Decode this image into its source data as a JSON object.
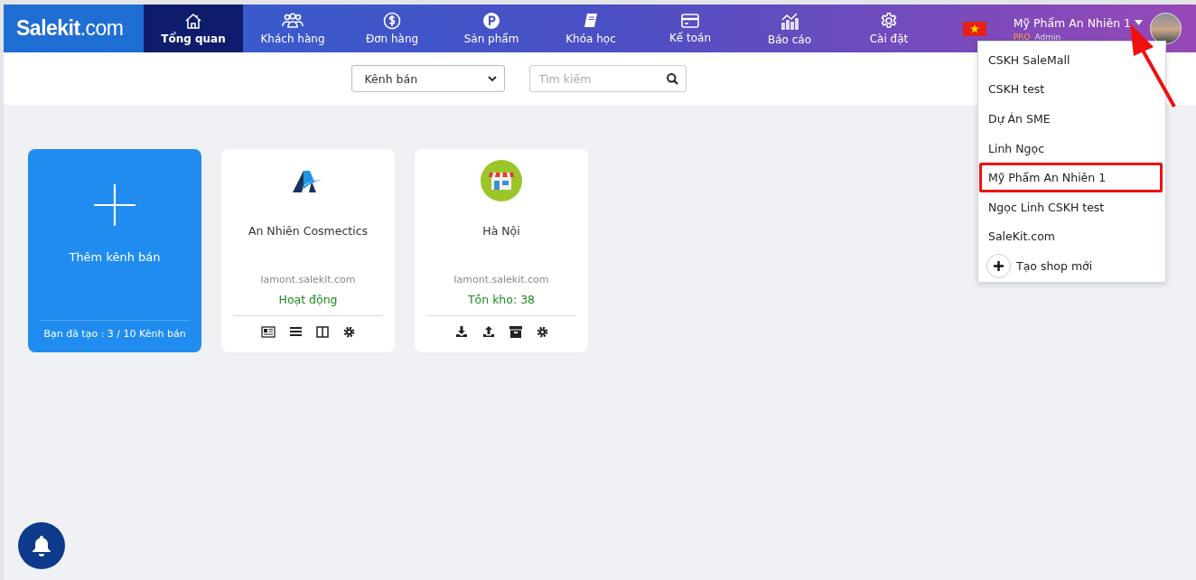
{
  "logo": {
    "name": "Salekit",
    "suffix": ".com"
  },
  "nav": [
    {
      "label": "Tổng quan",
      "selected": true
    },
    {
      "label": "Khách hàng",
      "selected": false
    },
    {
      "label": "Đơn hàng",
      "selected": false
    },
    {
      "label": "Sản phẩm",
      "selected": false
    },
    {
      "label": "Khóa học",
      "selected": false
    },
    {
      "label": "Kế toán",
      "selected": false
    },
    {
      "label": "Báo cáo",
      "selected": false
    },
    {
      "label": "Cài đặt",
      "selected": false
    }
  ],
  "account": {
    "shop": "Mỹ Phẩm An Nhiên 1",
    "plan": "PRO",
    "role": "Admin"
  },
  "filters": {
    "channel_select": "Kênh bán",
    "search": {
      "placeholder": "Tìm kiếm"
    }
  },
  "cards": [
    {
      "kind": "add",
      "title": "Thêm kênh bán",
      "footer": "Bạn đã tạo : 3 / 10 Kênh bán"
    },
    {
      "kind": "brand",
      "title": "An Nhiên Cosmectics",
      "domain": "lamont.salekit.com",
      "status": "Hoạt động"
    },
    {
      "kind": "store",
      "title": "Hà Nội",
      "domain": "lamont.salekit.com",
      "status": "Tồn kho: 38"
    }
  ],
  "shop_menu": {
    "items": [
      {
        "label": "CSKH SaleMall",
        "selected": false
      },
      {
        "label": "CSKH test",
        "selected": false
      },
      {
        "label": "Dự Án SME",
        "selected": false
      },
      {
        "label": "Linh Ngọc",
        "selected": false
      },
      {
        "label": "Mỹ Phẩm An Nhiên 1",
        "selected": true
      },
      {
        "label": "Ngọc Linh CSKH test",
        "selected": false
      },
      {
        "label": "SaleKit.com",
        "selected": false
      }
    ],
    "create": "Tạo shop mới"
  }
}
